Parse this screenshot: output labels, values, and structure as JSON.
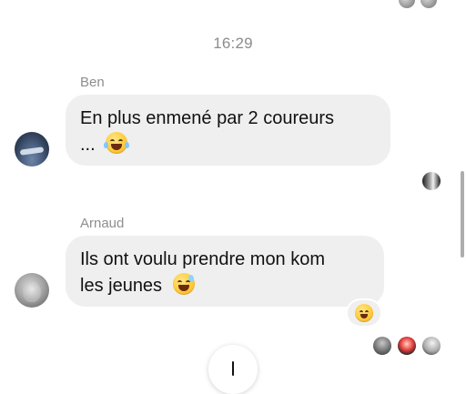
{
  "timestamp": "16:29",
  "messages": [
    {
      "sender": "Ben",
      "lines": [
        "En plus enmené par 2 coureurs",
        "..."
      ],
      "emoji": "face-with-tears-of-joy"
    },
    {
      "sender": "Arnaud",
      "lines": [
        "Ils ont voulu prendre mon kom",
        "les jeunes"
      ],
      "emoji": "grinning-face-with-sweat",
      "reaction": "grinning-squinting-face"
    }
  ]
}
